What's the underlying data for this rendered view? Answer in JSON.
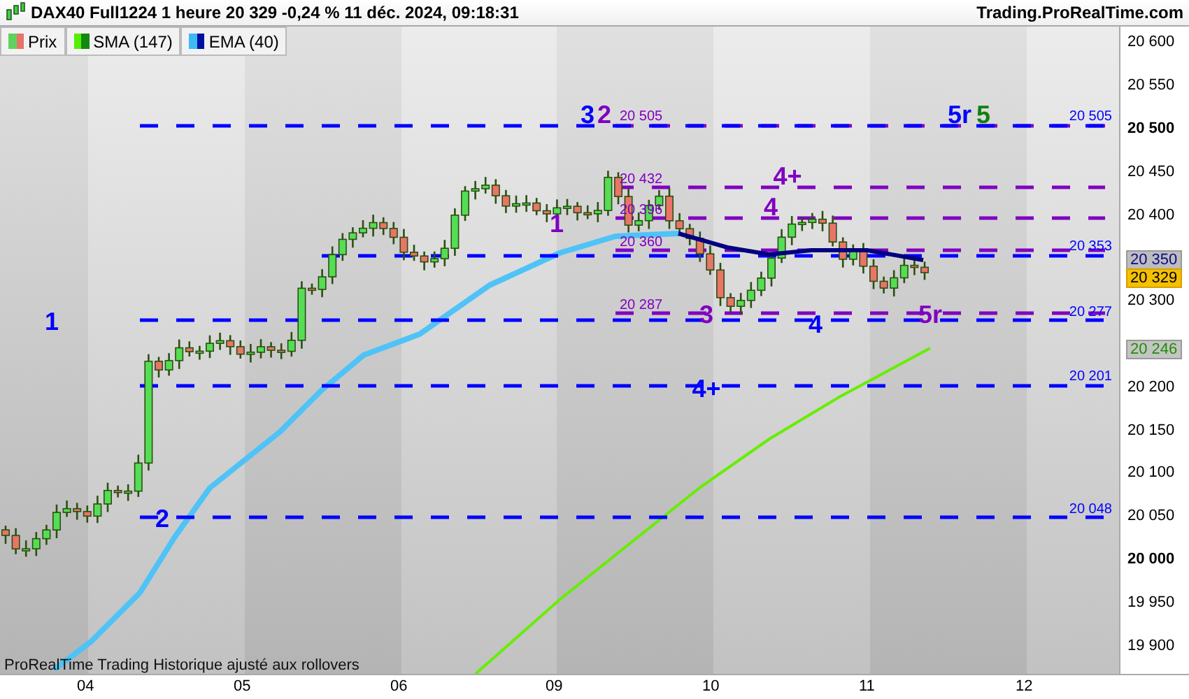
{
  "header": {
    "title": "DAX40 Full1224 1 heure 20 329 -0,24 % 11 déc. 2024, 09:18:31",
    "site": "Trading.ProRealTime.com"
  },
  "legend": [
    {
      "label": "Prix",
      "kind": "price"
    },
    {
      "label": "SMA (147)",
      "kind": "sma"
    },
    {
      "label": "EMA (40)",
      "kind": "ema"
    }
  ],
  "chart": {
    "levels": [
      {
        "label": "20 505",
        "color": "#8000c0"
      },
      {
        "label": "20 505",
        "color": "#0000ff"
      },
      {
        "label": "20 432",
        "color": "#8000c0"
      },
      {
        "label": "20 396",
        "color": "#8000c0"
      },
      {
        "label": "20 360",
        "color": "#8000c0"
      },
      {
        "label": "20 353",
        "color": "#0000ff"
      },
      {
        "label": "20 287",
        "color": "#8000c0"
      },
      {
        "label": "20 277",
        "color": "#0000ff"
      },
      {
        "label": "20 201",
        "color": "#0000ff"
      },
      {
        "label": "20 048",
        "color": "#0000ff"
      }
    ],
    "wave_labels": [
      {
        "text": "1",
        "color": "#0000ff"
      },
      {
        "text": "2",
        "color": "#0000ff"
      },
      {
        "text": "3",
        "color": "#0000ff"
      },
      {
        "text": "2",
        "color": "#8000c0"
      },
      {
        "text": "1",
        "color": "#8000c0"
      },
      {
        "text": "4+",
        "color": "#8000c0"
      },
      {
        "text": "4",
        "color": "#8000c0"
      },
      {
        "text": "3",
        "color": "#8000c0"
      },
      {
        "text": "4",
        "color": "#0000ff"
      },
      {
        "text": "4+",
        "color": "#0000ff"
      },
      {
        "text": "5r",
        "color": "#0000ff"
      },
      {
        "text": "5",
        "color": "#108010"
      },
      {
        "text": "5r",
        "color": "#8000c0"
      }
    ],
    "footer_note": "ProRealTime Trading  Historique ajusté aux rollovers",
    "y_ticks": [
      {
        "label": "20 600",
        "bold": false
      },
      {
        "label": "20 550",
        "bold": false
      },
      {
        "label": "20 500",
        "bold": true
      },
      {
        "label": "20 450",
        "bold": false
      },
      {
        "label": "20 400",
        "bold": false
      },
      {
        "label": "20 300",
        "bold": false
      },
      {
        "label": "20 200",
        "bold": false
      },
      {
        "label": "20 150",
        "bold": false
      },
      {
        "label": "20 100",
        "bold": false
      },
      {
        "label": "20 050",
        "bold": false
      },
      {
        "label": "20 000",
        "bold": true
      },
      {
        "label": "19 950",
        "bold": false
      },
      {
        "label": "19 900",
        "bold": false
      }
    ],
    "price_tags": [
      {
        "label": "20 350",
        "kind": "level"
      },
      {
        "label": "20 329",
        "kind": "last"
      },
      {
        "label": "20 246",
        "kind": "sma"
      }
    ],
    "x_ticks": [
      "04",
      "05",
      "06",
      "09",
      "10",
      "11",
      "12"
    ]
  }
}
